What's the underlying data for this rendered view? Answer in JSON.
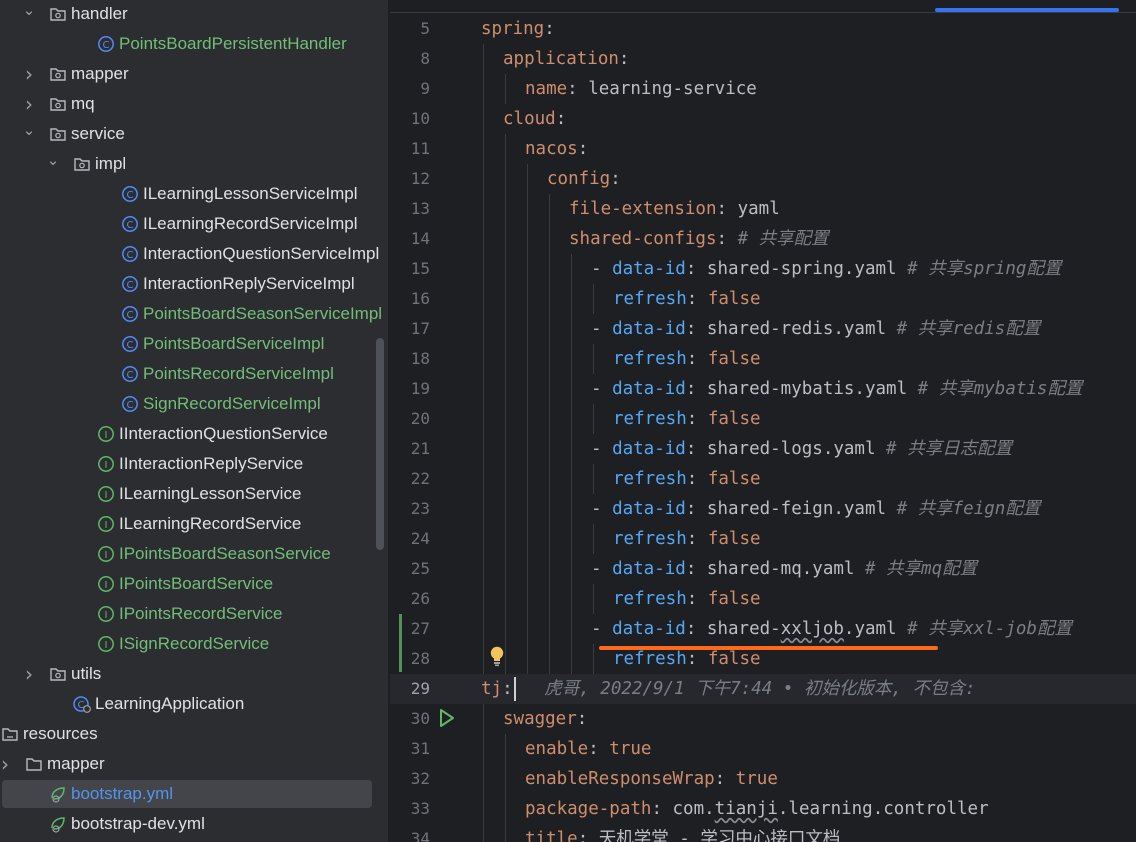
{
  "colors": {
    "green_text": "#73bd79",
    "blue_text": "#5394ec",
    "default_text": "#dfe1e5",
    "yaml_key": "#cf8e6d",
    "annotation": "#ff6a1a"
  },
  "tree": [
    {
      "label": "handler",
      "kind": "folder",
      "expanded": true,
      "indent": 1,
      "color": "default"
    },
    {
      "label": "PointsBoardPersistentHandler",
      "kind": "class",
      "indent": 3,
      "color": "green"
    },
    {
      "label": "mapper",
      "kind": "folder",
      "expanded": false,
      "indent": 1,
      "color": "default"
    },
    {
      "label": "mq",
      "kind": "folder",
      "expanded": false,
      "indent": 1,
      "color": "default"
    },
    {
      "label": "service",
      "kind": "folder",
      "expanded": true,
      "indent": 1,
      "color": "default"
    },
    {
      "label": "impl",
      "kind": "folder",
      "expanded": true,
      "indent": 2,
      "color": "default"
    },
    {
      "label": "ILearningLessonServiceImpl",
      "kind": "class",
      "indent": 4,
      "color": "default"
    },
    {
      "label": "ILearningRecordServiceImpl",
      "kind": "class",
      "indent": 4,
      "color": "default"
    },
    {
      "label": "InteractionQuestionServiceImpl",
      "kind": "class",
      "indent": 4,
      "color": "default"
    },
    {
      "label": "InteractionReplyServiceImpl",
      "kind": "class",
      "indent": 4,
      "color": "default"
    },
    {
      "label": "PointsBoardSeasonServiceImpl",
      "kind": "class",
      "indent": 4,
      "color": "green"
    },
    {
      "label": "PointsBoardServiceImpl",
      "kind": "class",
      "indent": 4,
      "color": "green"
    },
    {
      "label": "PointsRecordServiceImpl",
      "kind": "class",
      "indent": 4,
      "color": "green"
    },
    {
      "label": "SignRecordServiceImpl",
      "kind": "class",
      "indent": 4,
      "color": "green"
    },
    {
      "label": "IInteractionQuestionService",
      "kind": "interface",
      "indent": 3,
      "color": "default"
    },
    {
      "label": "IInteractionReplyService",
      "kind": "interface",
      "indent": 3,
      "color": "default"
    },
    {
      "label": "ILearningLessonService",
      "kind": "interface",
      "indent": 3,
      "color": "default"
    },
    {
      "label": "ILearningRecordService",
      "kind": "interface",
      "indent": 3,
      "color": "default"
    },
    {
      "label": "IPointsBoardSeasonService",
      "kind": "interface",
      "indent": 3,
      "color": "green"
    },
    {
      "label": "IPointsBoardService",
      "kind": "interface",
      "indent": 3,
      "color": "green"
    },
    {
      "label": "IPointsRecordService",
      "kind": "interface",
      "indent": 3,
      "color": "green"
    },
    {
      "label": "ISignRecordService",
      "kind": "interface",
      "indent": 3,
      "color": "green"
    },
    {
      "label": "utils",
      "kind": "folder",
      "expanded": false,
      "indent": 1,
      "color": "default"
    },
    {
      "label": "LearningApplication",
      "kind": "app",
      "indent": 2,
      "color": "default"
    },
    {
      "label": "resources",
      "kind": "resfolder",
      "expanded": true,
      "indent": -1,
      "color": "default"
    },
    {
      "label": "mapper",
      "kind": "plainfolder",
      "expanded": false,
      "indent": 0,
      "color": "default"
    },
    {
      "label": "bootstrap.yml",
      "kind": "yml",
      "indent": 1,
      "color": "blue",
      "selected": true
    },
    {
      "label": "bootstrap-dev.yml",
      "kind": "yml",
      "indent": 1,
      "color": "default"
    }
  ],
  "editor": {
    "lines": [
      {
        "n": "5",
        "indent": 0,
        "tokens": [
          [
            "k",
            "spring"
          ],
          [
            "p",
            ":"
          ]
        ]
      },
      {
        "n": "8",
        "indent": 1,
        "tokens": [
          [
            "k",
            "application"
          ],
          [
            "p",
            ":"
          ]
        ]
      },
      {
        "n": "9",
        "indent": 2,
        "tokens": [
          [
            "k",
            "name"
          ],
          [
            "p",
            ": "
          ],
          [
            "v",
            "learning-service"
          ]
        ]
      },
      {
        "n": "10",
        "indent": 1,
        "tokens": [
          [
            "k",
            "cloud"
          ],
          [
            "p",
            ":"
          ]
        ]
      },
      {
        "n": "11",
        "indent": 2,
        "tokens": [
          [
            "k",
            "nacos"
          ],
          [
            "p",
            ":"
          ]
        ]
      },
      {
        "n": "12",
        "indent": 3,
        "tokens": [
          [
            "k",
            "config"
          ],
          [
            "p",
            ":"
          ]
        ]
      },
      {
        "n": "13",
        "indent": 4,
        "tokens": [
          [
            "k",
            "file-extension"
          ],
          [
            "p",
            ": "
          ],
          [
            "v",
            "yaml"
          ]
        ]
      },
      {
        "n": "14",
        "indent": 4,
        "tokens": [
          [
            "k",
            "shared-configs"
          ],
          [
            "p",
            ": "
          ],
          [
            "c",
            "# 共享配置"
          ]
        ]
      },
      {
        "n": "15",
        "indent": 5,
        "tokens": [
          [
            "p",
            "- "
          ],
          [
            "k2",
            "data-id"
          ],
          [
            "p",
            ": "
          ],
          [
            "v",
            "shared-spring.yaml "
          ],
          [
            "c",
            "# 共享spring配置"
          ]
        ]
      },
      {
        "n": "16",
        "indent": 6,
        "tokens": [
          [
            "k2",
            "refresh"
          ],
          [
            "p",
            ": "
          ],
          [
            "b",
            "false"
          ]
        ]
      },
      {
        "n": "17",
        "indent": 5,
        "tokens": [
          [
            "p",
            "- "
          ],
          [
            "k2",
            "data-id"
          ],
          [
            "p",
            ": "
          ],
          [
            "v",
            "shared-redis.yaml "
          ],
          [
            "c",
            "# 共享redis配置"
          ]
        ]
      },
      {
        "n": "18",
        "indent": 6,
        "tokens": [
          [
            "k2",
            "refresh"
          ],
          [
            "p",
            ": "
          ],
          [
            "b",
            "false"
          ]
        ]
      },
      {
        "n": "19",
        "indent": 5,
        "tokens": [
          [
            "p",
            "- "
          ],
          [
            "k2",
            "data-id"
          ],
          [
            "p",
            ": "
          ],
          [
            "v",
            "shared-mybatis.yaml "
          ],
          [
            "c",
            "# 共享mybatis配置"
          ]
        ]
      },
      {
        "n": "20",
        "indent": 6,
        "tokens": [
          [
            "k2",
            "refresh"
          ],
          [
            "p",
            ": "
          ],
          [
            "b",
            "false"
          ]
        ]
      },
      {
        "n": "21",
        "indent": 5,
        "tokens": [
          [
            "p",
            "- "
          ],
          [
            "k2",
            "data-id"
          ],
          [
            "p",
            ": "
          ],
          [
            "v",
            "shared-logs.yaml "
          ],
          [
            "c",
            "# 共享日志配置"
          ]
        ]
      },
      {
        "n": "22",
        "indent": 6,
        "tokens": [
          [
            "k2",
            "refresh"
          ],
          [
            "p",
            ": "
          ],
          [
            "b",
            "false"
          ]
        ]
      },
      {
        "n": "23",
        "indent": 5,
        "tokens": [
          [
            "p",
            "- "
          ],
          [
            "k2",
            "data-id"
          ],
          [
            "p",
            ": "
          ],
          [
            "v",
            "shared-feign.yaml "
          ],
          [
            "c",
            "# 共享feign配置"
          ]
        ]
      },
      {
        "n": "24",
        "indent": 6,
        "tokens": [
          [
            "k2",
            "refresh"
          ],
          [
            "p",
            ": "
          ],
          [
            "b",
            "false"
          ]
        ]
      },
      {
        "n": "25",
        "indent": 5,
        "tokens": [
          [
            "p",
            "- "
          ],
          [
            "k2",
            "data-id"
          ],
          [
            "p",
            ": "
          ],
          [
            "v",
            "shared-mq.yaml "
          ],
          [
            "c",
            "# 共享mq配置"
          ]
        ]
      },
      {
        "n": "26",
        "indent": 6,
        "tokens": [
          [
            "k2",
            "refresh"
          ],
          [
            "p",
            ": "
          ],
          [
            "b",
            "false"
          ]
        ]
      },
      {
        "n": "27",
        "indent": 5,
        "tokens": [
          [
            "p",
            "- "
          ],
          [
            "k2",
            "data-id"
          ],
          [
            "p",
            ": "
          ],
          [
            "v",
            "shared-"
          ],
          [
            "sq",
            "xxljob"
          ],
          [
            "v",
            ".yaml "
          ],
          [
            "c",
            "# 共享xxl-job配置"
          ]
        ]
      },
      {
        "n": "28",
        "indent": 6,
        "tokens": [
          [
            "k2",
            "refresh"
          ],
          [
            "p",
            ": "
          ],
          [
            "b",
            "false"
          ]
        ]
      },
      {
        "n": "29",
        "indent": 0,
        "current": true,
        "tokens": [
          [
            "k",
            "tj"
          ],
          [
            "p",
            ":"
          ],
          [
            "c",
            "   虎哥, 2022/9/1 下午7:44 • 初始化版本, 不包含:"
          ]
        ]
      },
      {
        "n": "30",
        "indent": 1,
        "tokens": [
          [
            "k",
            "swagger"
          ],
          [
            "p",
            ":"
          ]
        ]
      },
      {
        "n": "31",
        "indent": 2,
        "tokens": [
          [
            "k",
            "enable"
          ],
          [
            "p",
            ": "
          ],
          [
            "b",
            "true"
          ]
        ]
      },
      {
        "n": "32",
        "indent": 2,
        "tokens": [
          [
            "k",
            "enableResponseWrap"
          ],
          [
            "p",
            ": "
          ],
          [
            "b",
            "true"
          ]
        ]
      },
      {
        "n": "33",
        "indent": 2,
        "tokens": [
          [
            "k",
            "package-path"
          ],
          [
            "p",
            ": "
          ],
          [
            "v",
            "com."
          ],
          [
            "sq",
            "tianji"
          ],
          [
            "v",
            ".learning.controller"
          ]
        ]
      },
      {
        "n": "34",
        "indent": 2,
        "tokens": [
          [
            "k",
            "title"
          ],
          [
            "p",
            ": "
          ],
          [
            "v",
            "天机学堂 - 学习中心接口文档"
          ]
        ]
      }
    ]
  },
  "icons": {
    "bulb": "lightbulb-icon",
    "run": "run-gutter-icon"
  }
}
